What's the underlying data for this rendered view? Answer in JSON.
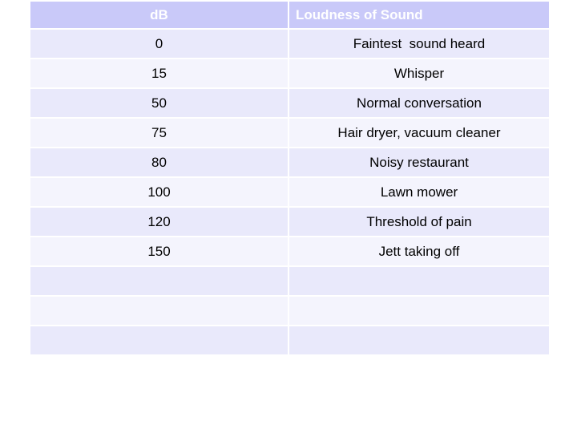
{
  "table": {
    "headers": [
      "dB",
      "Loudness of Sound"
    ],
    "rows": [
      [
        "0",
        "Faintest  sound heard"
      ],
      [
        "15",
        "Whisper"
      ],
      [
        "50",
        "Normal conversation"
      ],
      [
        "75",
        "Hair dryer, vacuum cleaner"
      ],
      [
        "80",
        "Noisy restaurant"
      ],
      [
        "100",
        "Lawn mower"
      ],
      [
        "120",
        "Threshold of pain"
      ],
      [
        "150",
        "Jett taking off"
      ],
      [
        "",
        ""
      ],
      [
        "",
        ""
      ],
      [
        "",
        ""
      ]
    ]
  },
  "colors": {
    "header_bg": "#c9c9f9",
    "header_text": "#ffffff",
    "row_odd_bg": "#e9e9fb",
    "row_even_bg": "#f4f4fd",
    "body_text": "#000000"
  }
}
